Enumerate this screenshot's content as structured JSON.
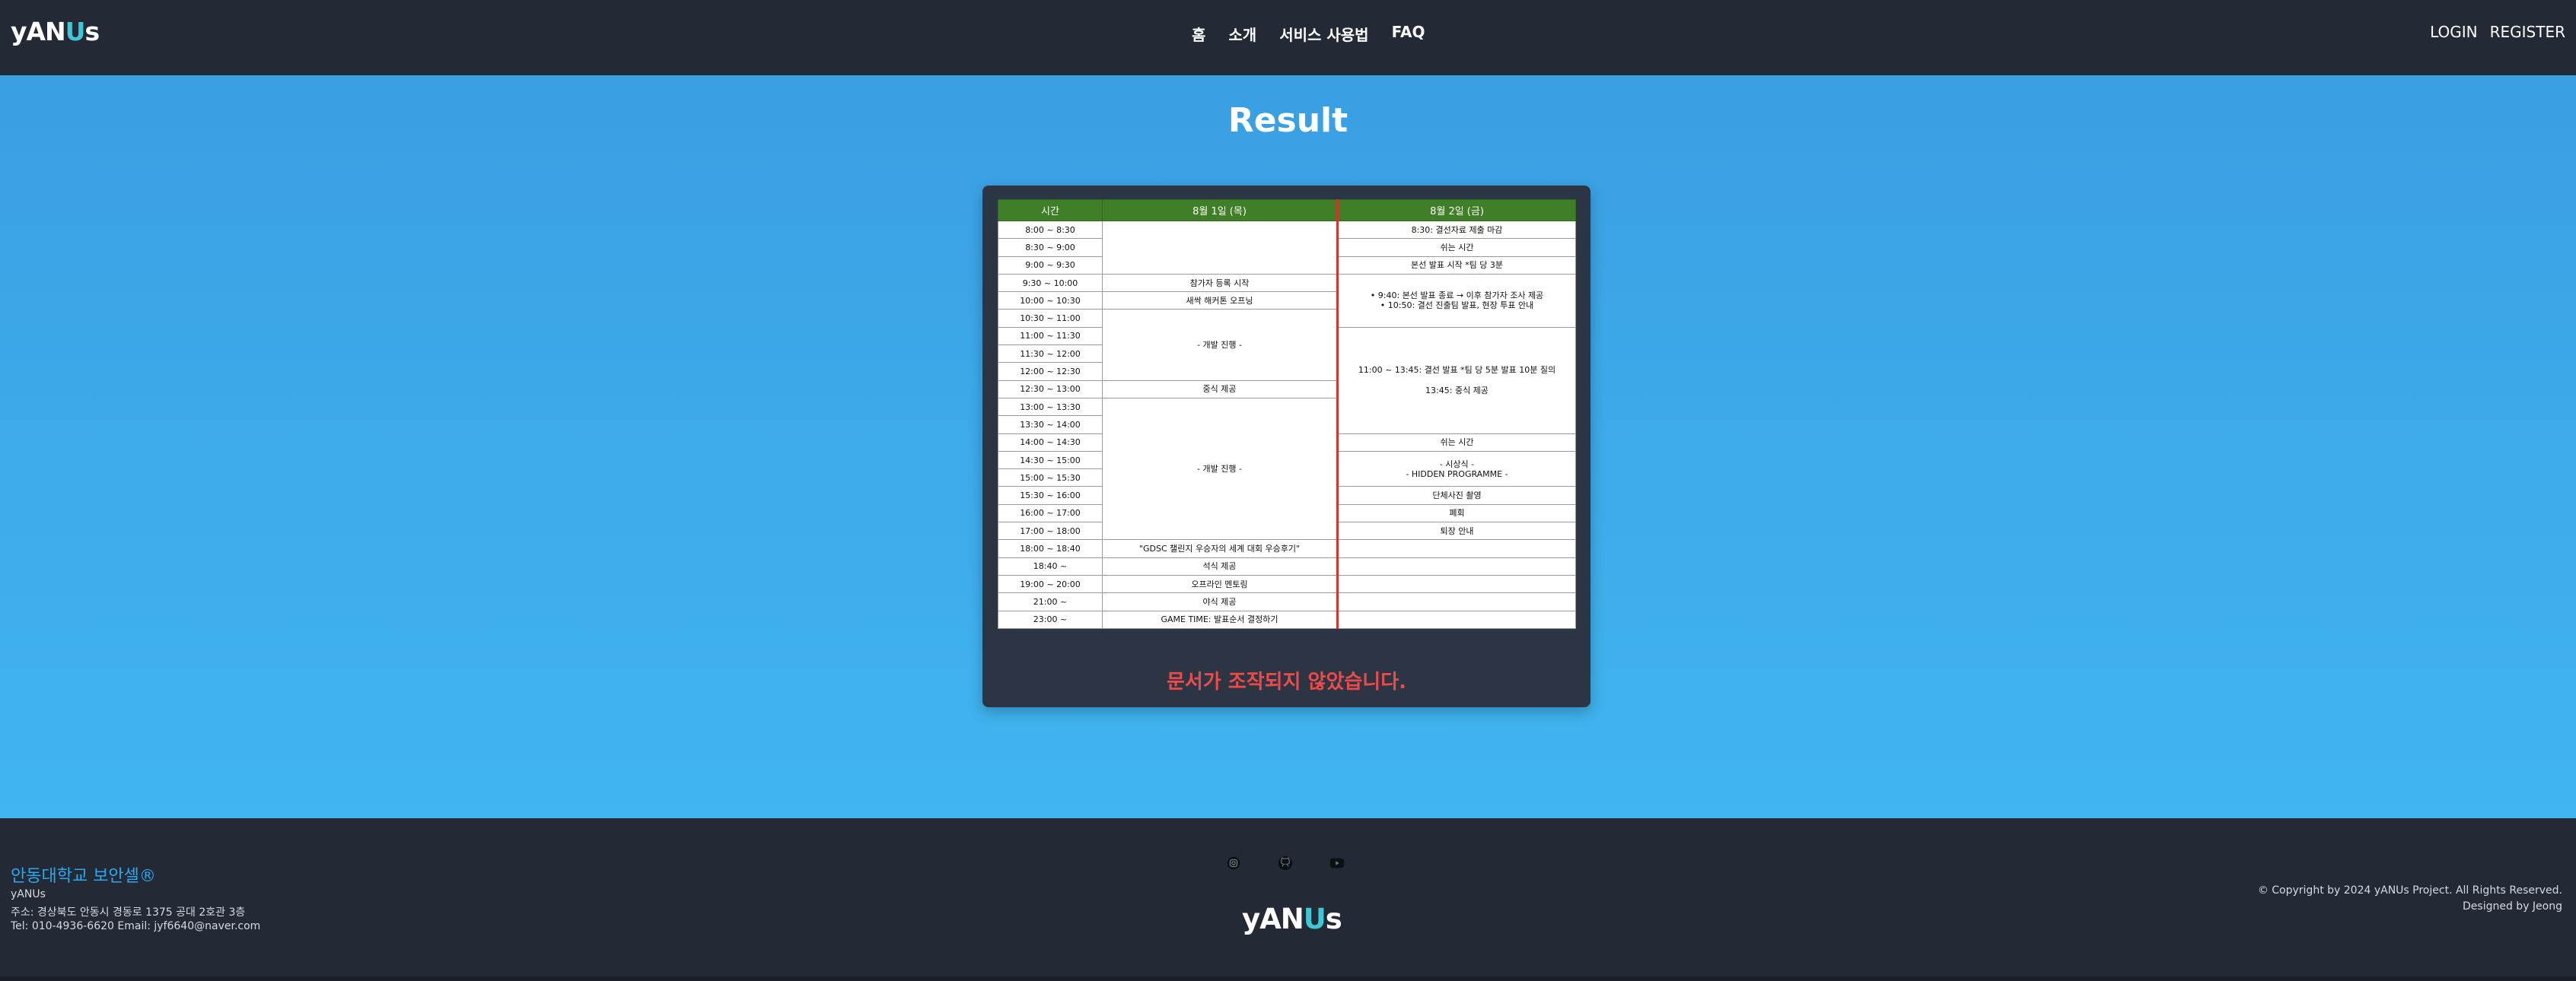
{
  "header": {
    "logo_left": "yAN",
    "logo_u": "U",
    "logo_right": "s",
    "nav": [
      "홈",
      "소개",
      "서비스 사용법",
      "FAQ"
    ],
    "login": "LOGIN",
    "register": "REGISTER"
  },
  "main": {
    "title": "Result",
    "table_headers": [
      "시간",
      "8월 1일 (목)",
      "8월 2일 (금)"
    ],
    "times": [
      "8:00 ~ 8:30",
      "8:30 ~ 9:00",
      "9:00 ~ 9:30",
      "9:30 ~ 10:00",
      "10:00 ~ 10:30",
      "10:30 ~ 11:00",
      "11:00 ~ 11:30",
      "11:30 ~ 12:00",
      "12:00 ~ 12:30",
      "12:30 ~ 13:00",
      "13:00 ~ 13:30",
      "13:30 ~ 14:00",
      "14:00 ~ 14:30",
      "14:30 ~ 15:00",
      "15:00 ~ 15:30",
      "15:30 ~ 16:00",
      "16:00 ~ 17:00",
      "17:00 ~ 18:00",
      "18:00 ~ 18:40",
      "18:40 ~",
      "19:00 ~ 20:00",
      "21:00 ~",
      "23:00 ~"
    ],
    "day1": {
      "registration": "참가자 등록 시작",
      "opening": "새싹 해커톤 오프닝",
      "dev1": "- 개발 진행 -",
      "lunch": "중식 제공",
      "dev2": "- 개발 진행 -",
      "talk": "\"GDSC 챌린지 우승자의 세계 대회 우승후기\"",
      "dinner": "석식 제공",
      "mentoring": "오프라인 멘토링",
      "night_snack": "야식 제공",
      "game": "GAME TIME: 발표순서 결정하기"
    },
    "day2": {
      "submit": "8:30: 결선자료 제출 마감",
      "break1": "쉬는 시간",
      "presentation_start": "본선 발표 시작 *팀 당 3분",
      "final_a": "• 9:40: 본선 발표 종료 → 이후 참가자 조사 제공",
      "final_b": "• 10:50: 결선 진출팀 발표, 현장 투표 안내",
      "final_pres": "11:00 ~ 13:45: 결선 발표 *팀 당 5분 발표 10분 질의",
      "lunch": "13:45: 중식 제공",
      "break2": "쉬는 시간",
      "ceremony_a": "- 시상식 -",
      "ceremony_b": "- HIDDEN PROGRAMME -",
      "group_photo": "단체사진 촬영",
      "cleanup": "폐회",
      "exit": "퇴장 안내"
    },
    "result_message": "문서가 조작되지 않았습니다."
  },
  "footer": {
    "org": "안동대학교 보안셀®",
    "team": "yANUs",
    "address": "주소: 경상북도 안동시 경동로 1375 공대 2호관 3층",
    "contact": "Tel: 010-4936-6620 Email: jyf6640@naver.com",
    "icons": [
      "instagram-icon",
      "github-icon",
      "youtube-icon"
    ],
    "copyright": "© Copyright by 2024 yANUs Project. All Rights Reserved.",
    "designer": "Designed by Jeong"
  }
}
